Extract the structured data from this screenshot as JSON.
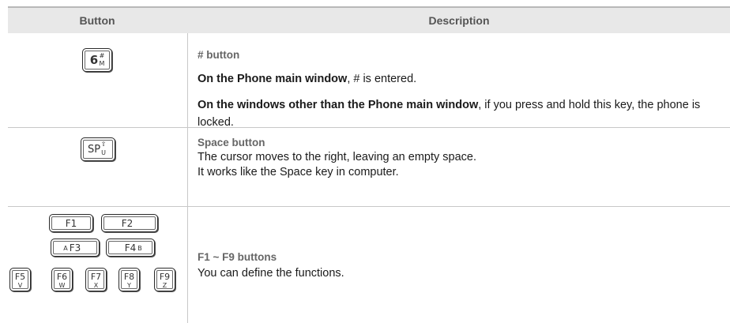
{
  "header": {
    "button": "Button",
    "description": "Description"
  },
  "rows": [
    {
      "key": {
        "main": "6",
        "upper": "#",
        "lower": "M"
      },
      "title": "# button",
      "line1_bold": "On the Phone main window",
      "line1_rest": ", # is entered.",
      "line2_bold": "On the windows other than the Phone main window",
      "line2_rest": ", if you press and hold this key, the phone is locked."
    },
    {
      "key": {
        "main": "SP",
        "upper": "⇧",
        "lower": "U"
      },
      "title": "Space button",
      "line1": "The cursor moves to the right, leaving an empty space.",
      "line2": "It works like the Space key in computer."
    },
    {
      "keys_top": [
        "F1",
        "F2"
      ],
      "keys_mid": [
        {
          "prefix": "A",
          "label": "F3"
        },
        {
          "label": "F4",
          "suffix": "B"
        }
      ],
      "keys_small": [
        {
          "label": "F5",
          "sub": "V"
        },
        {
          "label": "F6",
          "sub": "W"
        },
        {
          "label": "F7",
          "sub": "X"
        },
        {
          "label": "F8",
          "sub": "Y"
        },
        {
          "label": "F9",
          "sub": "Z"
        }
      ],
      "title": "F1 ~ F9 buttons",
      "line1": "You can define the functions."
    }
  ]
}
